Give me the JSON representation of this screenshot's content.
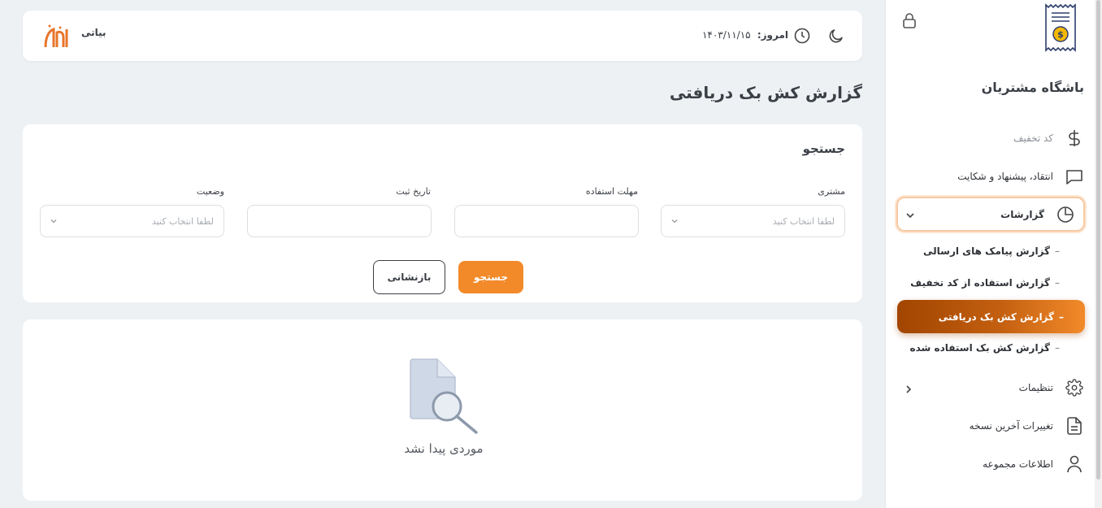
{
  "sidebar": {
    "club_title": "باشگاه مشتریان",
    "items": [
      {
        "label": "کد تخفیف",
        "icon": "dollar-icon"
      },
      {
        "label": "انتقاد، پیشنهاد و شکایت",
        "icon": "message-icon"
      },
      {
        "label": "گزارشات",
        "icon": "pie-chart-icon"
      },
      {
        "label": "تنظیمات",
        "icon": "gear-icon"
      },
      {
        "label": "تغییرات آخرین نسخه",
        "icon": "document-icon"
      },
      {
        "label": "اطلاعات مجموعه",
        "icon": "user-icon"
      }
    ],
    "sub_items": [
      {
        "label": "گزارش پیامک های ارسالی"
      },
      {
        "label": "گزارش استفاده از کد تخفیف"
      },
      {
        "label": "گزارش کش بک دریافتی"
      },
      {
        "label": "گزارش کش بک استفاده شده"
      }
    ],
    "dash": "–"
  },
  "header": {
    "today_label": "امروز:",
    "today_date": "۱۴۰۳/۱۱/۱۵",
    "user_name": "بیاتی"
  },
  "page": {
    "title": "گزارش کش بک دریافتی"
  },
  "search": {
    "title": "جستجو",
    "fields": [
      {
        "label": "مشتری",
        "placeholder": "لطفا انتخاب کنید"
      },
      {
        "label": "مهلت استفاده",
        "placeholder": ""
      },
      {
        "label": "تاریخ ثبت",
        "placeholder": ""
      },
      {
        "label": "وضعیت",
        "placeholder": "لطفا انتخاب کنید"
      }
    ],
    "search_button": "جستجو",
    "reset_button": "بازنشانی"
  },
  "results": {
    "empty_text": "موردی پیدا نشد"
  },
  "colors": {
    "accent": "#f28a2a",
    "accent_dark": "#a14500",
    "text": "#3b3f46"
  }
}
